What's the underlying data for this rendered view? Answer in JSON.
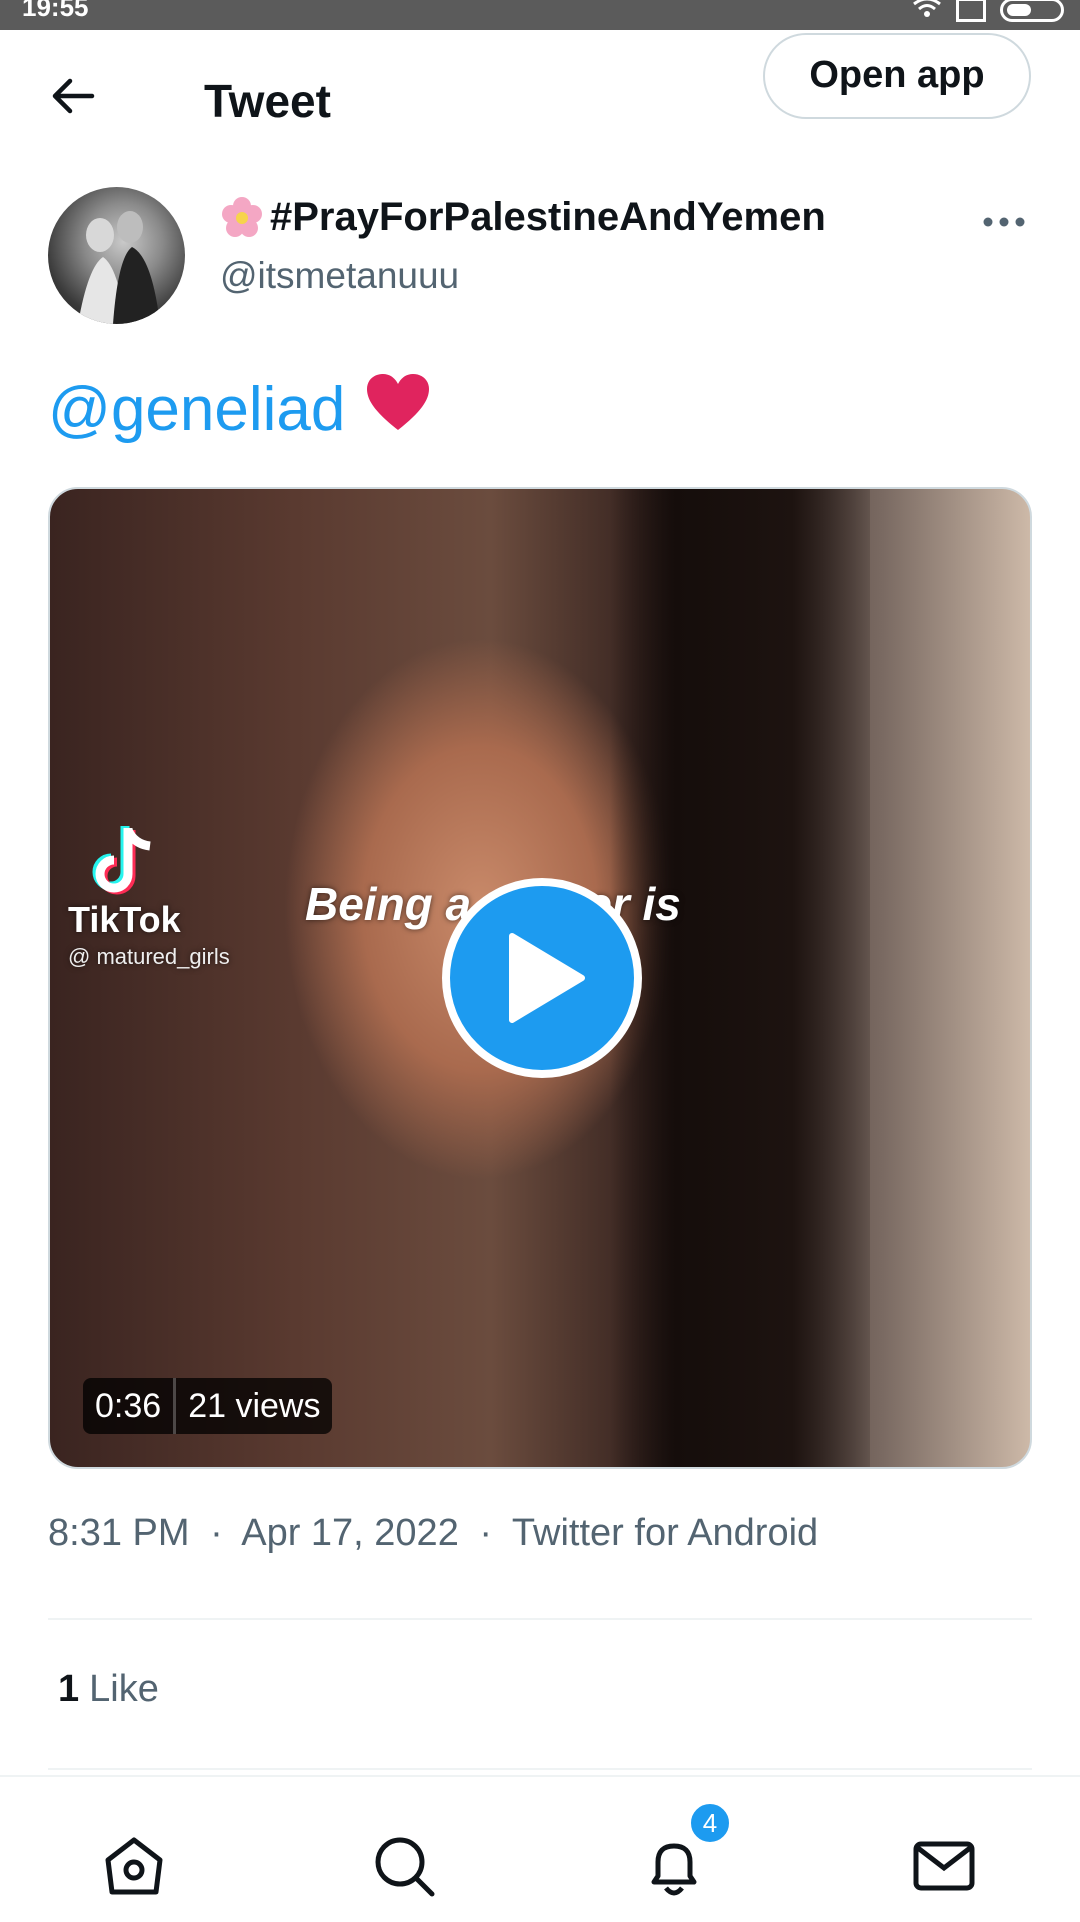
{
  "status_bar": {
    "time": "19:55"
  },
  "header": {
    "title": "Tweet",
    "open_app_label": "Open app"
  },
  "author": {
    "display_name": "#PrayForPalestineAndYemen",
    "handle": "@itsmetanuuu"
  },
  "tweet": {
    "mention": "@geneliad",
    "emoji": "❤️"
  },
  "media": {
    "overlay_caption": "Being a ... aker is",
    "tiktok_brand": "TikTok",
    "tiktok_user": "@ matured_girls",
    "duration": "0:36",
    "views": "21 views"
  },
  "meta": {
    "time": "8:31 PM",
    "date": "Apr 17, 2022",
    "source": "Twitter for Android",
    "separator": "·"
  },
  "stats": {
    "like_count": "1",
    "like_label": "Like"
  },
  "bottom_nav": {
    "notification_count": "4"
  },
  "colors": {
    "accent": "#1d9bf0",
    "heart": "#e0245e",
    "text": "#0f1419",
    "muted": "#536471"
  }
}
